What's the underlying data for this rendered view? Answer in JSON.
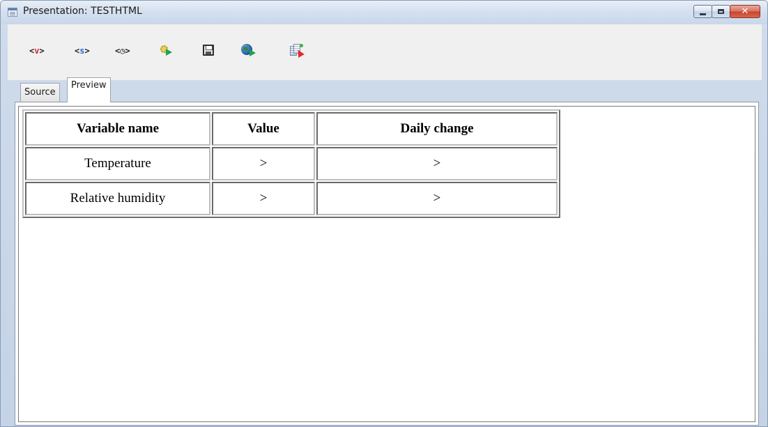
{
  "window": {
    "title": "Presentation: TESTHTML",
    "close_glyph": "✕"
  },
  "toolbar": {
    "buttons": [
      {
        "id": "insert-variable",
        "text_left": "<",
        "text_mid": "v",
        "text_right": ">",
        "icon": "insert-variable-icon"
      },
      {
        "id": "insert-script",
        "text_left": "<",
        "text_mid": "s",
        "text_right": ">",
        "icon": "insert-script-icon"
      },
      {
        "id": "insert-time",
        "text_left": "<",
        "text_mid": "◷",
        "text_right": ">",
        "icon": "insert-time-icon"
      },
      {
        "id": "run",
        "icon": "gear-run-icon"
      },
      {
        "id": "save",
        "icon": "save-icon"
      },
      {
        "id": "preview-browser",
        "icon": "globe-run-icon"
      },
      {
        "id": "select",
        "icon": "select-element-icon"
      }
    ]
  },
  "tabs": [
    {
      "label": "Source",
      "active": false
    },
    {
      "label": "Preview",
      "active": true
    }
  ],
  "table": {
    "headers": [
      "Variable name",
      "Value",
      "Daily change"
    ],
    "rows": [
      [
        "Temperature",
        ">",
        ">"
      ],
      [
        "Relative humidity",
        ">",
        ">"
      ]
    ]
  }
}
